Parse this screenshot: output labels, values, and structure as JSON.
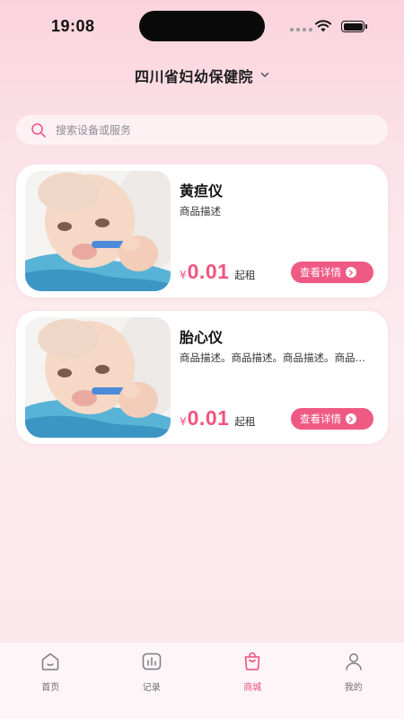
{
  "status_bar": {
    "time": "19:08"
  },
  "header": {
    "hospital_name": "四川省妇幼保健院"
  },
  "search": {
    "placeholder": "搜索设备或服务"
  },
  "products": [
    {
      "name": "黄疸仪",
      "description": "商品描述",
      "currency": "¥",
      "price": "0.01",
      "price_unit": "起租",
      "button_label": "查看详情"
    },
    {
      "name": "胎心仪",
      "description": "商品描述。商品描述。商品描述。商品描述。",
      "currency": "¥",
      "price": "0.01",
      "price_unit": "起租",
      "button_label": "查看详情"
    }
  ],
  "tabbar": {
    "items": [
      {
        "label": "首页",
        "icon": "home-icon",
        "active": false
      },
      {
        "label": "记录",
        "icon": "chart-icon",
        "active": false
      },
      {
        "label": "商城",
        "icon": "shopping-bag-icon",
        "active": true
      },
      {
        "label": "我的",
        "icon": "user-icon",
        "active": false
      }
    ]
  },
  "colors": {
    "accent": "#ef5a85",
    "price": "#f25480",
    "background": "#fbe3e8"
  }
}
